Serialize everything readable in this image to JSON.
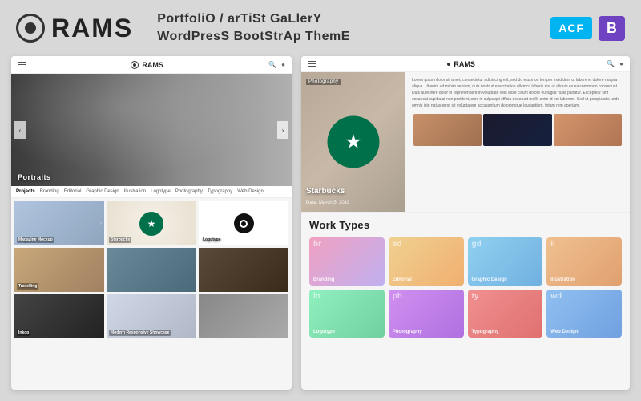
{
  "header": {
    "logo_text": "RAMS",
    "subtitle_line1": "PortfoliO / arTiSt GaLlerY",
    "subtitle_line2": "WordPresS BootStrAp ThemE",
    "badge_acf": "ACF",
    "badge_b": "B"
  },
  "left_preview": {
    "logo": "RAMS",
    "hero_label": "Portraits",
    "filter_tabs": [
      "Projects",
      "Branding",
      "Editorial",
      "Graphic Design",
      "Illustration",
      "Logotype",
      "Photography",
      "Typography",
      "Web Design"
    ],
    "grid_items": [
      {
        "label": "Magazine Mockup",
        "type": "magazine"
      },
      {
        "label": "Starbucks",
        "type": "starbucks"
      },
      {
        "label": "Logotype",
        "type": "logo"
      },
      {
        "label": "Travelling",
        "type": "travel"
      },
      {
        "label": "",
        "type": "city"
      },
      {
        "label": "",
        "type": "texture"
      },
      {
        "label": "Inkop",
        "type": "dark"
      },
      {
        "label": "Modern Responsive Showcase",
        "type": "phone"
      },
      {
        "label": "",
        "type": "medium"
      }
    ]
  },
  "right_preview": {
    "logo": "RAMS",
    "photography_label": "Photography",
    "starbucks_title": "Starbucks",
    "starbucks_date": "Date: March 5, 2019",
    "lorem_text": "Lorem ipsum dolor sit amet, consectetur adipiscing elit, sed do eiusmod tempor incididunt ut labore et dolore magna aliqua. Ut enim ad minim veniam, quis nostrud exercitation ullamco laboris nisi ut aliquip ex ea commodo consequat. Duis aute irure dolor in reprehenderit in voluptate velit esse cillum dolore eu fugiat nulla pariatur. Excepteur sint occaecat cupidatat non proident, sunt in culpa qui officia deserunt mollit anim id est laborum. Sed ut perspiciatis unde omnis iste natus error sit voluptatem accusantium doloremque laudantium, totam rem aperiam."
  },
  "work_types": {
    "title": "Work Types",
    "cards": [
      {
        "label_top": "br",
        "label": "Branding"
      },
      {
        "label_top": "ed",
        "label": "Editorial"
      },
      {
        "label_top": "gd",
        "label": "Graphic Design"
      },
      {
        "label_top": "il",
        "label": "Illustration"
      },
      {
        "label_top": "lo",
        "label": "Logotype"
      },
      {
        "label_top": "ph",
        "label": "Photography"
      },
      {
        "label_top": "ty",
        "label": "Typography"
      },
      {
        "label_top": "wd",
        "label": "Web Design"
      }
    ]
  }
}
